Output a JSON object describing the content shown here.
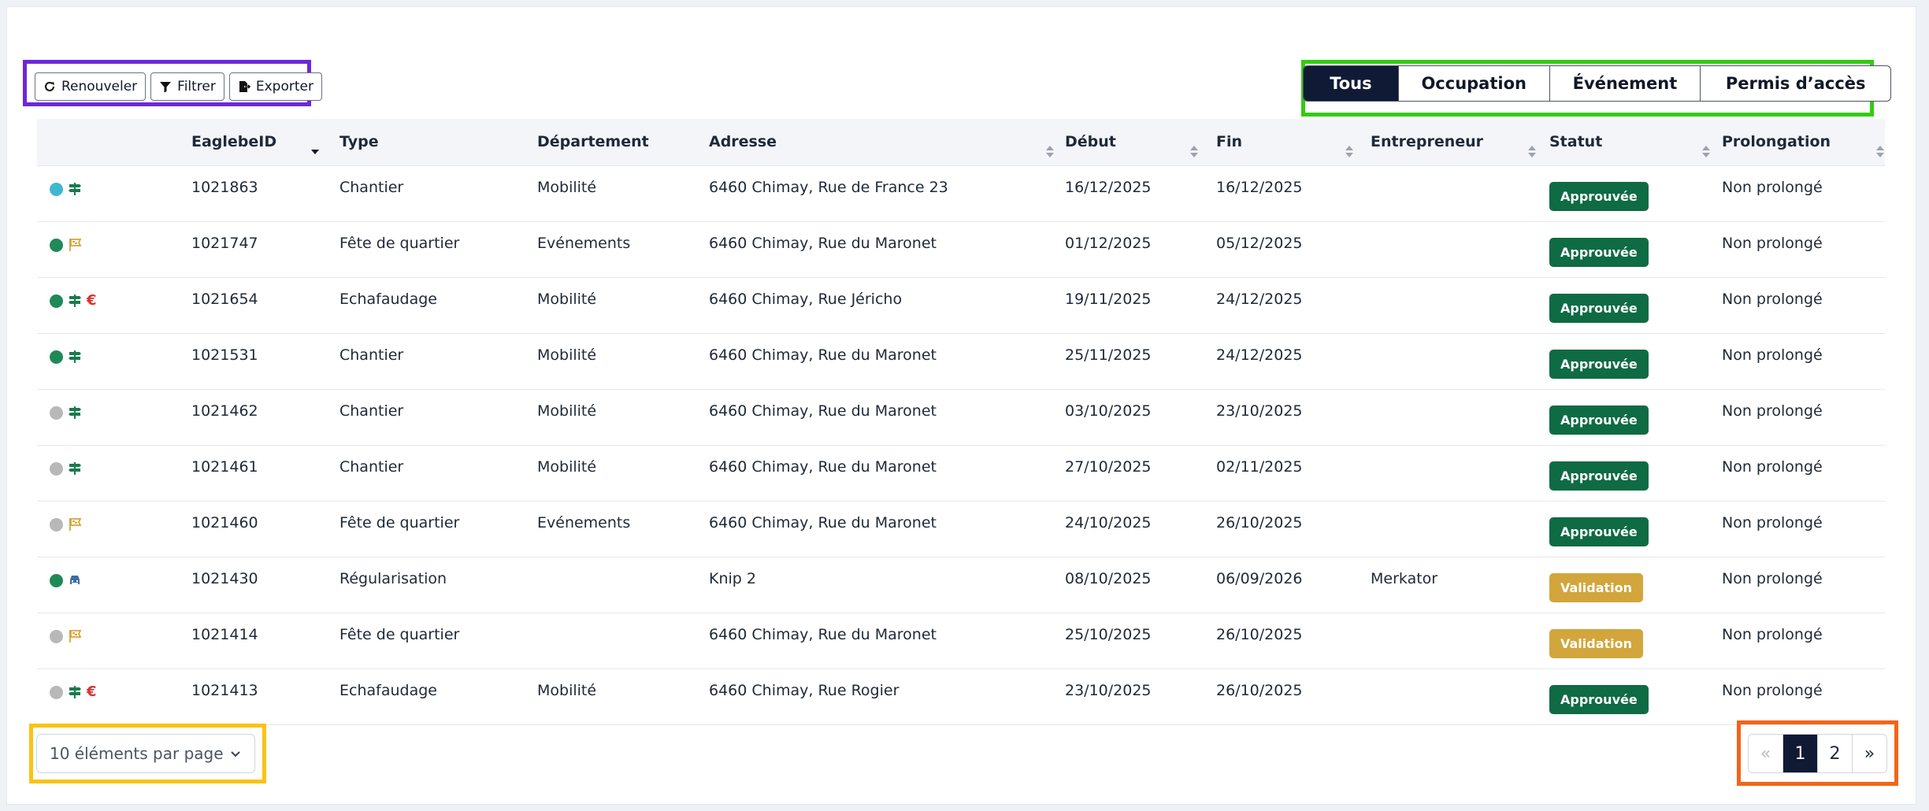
{
  "toolbar": {
    "renew_label": "Renouveler",
    "filter_label": "Filtrer",
    "export_label": "Exporter"
  },
  "tabs": [
    {
      "label": "Tous",
      "active": true
    },
    {
      "label": "Occupation",
      "active": false
    },
    {
      "label": "Événement",
      "active": false
    },
    {
      "label": "Permis d’accès",
      "active": false
    }
  ],
  "table": {
    "columns": [
      "EaglebeID",
      "Type",
      "Département",
      "Adresse",
      "Début",
      "Fin",
      "Entrepreneur",
      "Statut",
      "Prolongation"
    ],
    "rows": [
      {
        "dot": "#3fb8cf",
        "kind": "roadsign",
        "euro": false,
        "id": "1021863",
        "type": "Chantier",
        "dept": "Mobilité",
        "address": "6460 Chimay, Rue de France 23",
        "start": "16/12/2025",
        "end": "16/12/2025",
        "contractor": "",
        "status": "Approuvée",
        "status_kind": "approved",
        "extension": "Non prolongé"
      },
      {
        "dot": "#1f8a57",
        "kind": "flag",
        "euro": false,
        "id": "1021747",
        "type": "Fête de quartier",
        "dept": "Evénements",
        "address": "6460 Chimay, Rue du Maronet",
        "start": "01/12/2025",
        "end": "05/12/2025",
        "contractor": "",
        "status": "Approuvée",
        "status_kind": "approved",
        "extension": "Non prolongé"
      },
      {
        "dot": "#1f8a57",
        "kind": "roadsign",
        "euro": true,
        "id": "1021654",
        "type": "Echafaudage",
        "dept": "Mobilité",
        "address": "6460 Chimay, Rue Jéricho",
        "start": "19/11/2025",
        "end": "24/12/2025",
        "contractor": "",
        "status": "Approuvée",
        "status_kind": "approved",
        "extension": "Non prolongé"
      },
      {
        "dot": "#1f8a57",
        "kind": "roadsign",
        "euro": false,
        "id": "1021531",
        "type": "Chantier",
        "dept": "Mobilité",
        "address": "6460 Chimay, Rue du Maronet",
        "start": "25/11/2025",
        "end": "24/12/2025",
        "contractor": "",
        "status": "Approuvée",
        "status_kind": "approved",
        "extension": "Non prolongé"
      },
      {
        "dot": "#b8b8b8",
        "kind": "roadsign",
        "euro": false,
        "id": "1021462",
        "type": "Chantier",
        "dept": "Mobilité",
        "address": "6460 Chimay, Rue du Maronet",
        "start": "03/10/2025",
        "end": "23/10/2025",
        "contractor": "",
        "status": "Approuvée",
        "status_kind": "approved",
        "extension": "Non prolongé"
      },
      {
        "dot": "#b8b8b8",
        "kind": "roadsign",
        "euro": false,
        "id": "1021461",
        "type": "Chantier",
        "dept": "Mobilité",
        "address": "6460 Chimay, Rue du Maronet",
        "start": "27/10/2025",
        "end": "02/11/2025",
        "contractor": "",
        "status": "Approuvée",
        "status_kind": "approved",
        "extension": "Non prolongé"
      },
      {
        "dot": "#b8b8b8",
        "kind": "flag",
        "euro": false,
        "id": "1021460",
        "type": "Fête de quartier",
        "dept": "Evénements",
        "address": "6460 Chimay, Rue du Maronet",
        "start": "24/10/2025",
        "end": "26/10/2025",
        "contractor": "",
        "status": "Approuvée",
        "status_kind": "approved",
        "extension": "Non prolongé"
      },
      {
        "dot": "#1f8a57",
        "kind": "car",
        "euro": false,
        "id": "1021430",
        "type": "Régularisation",
        "dept": "",
        "address": "Knip 2",
        "start": "08/10/2025",
        "end": "06/09/2026",
        "contractor": "Merkator",
        "status": "Validation",
        "status_kind": "validation",
        "extension": "Non prolongé"
      },
      {
        "dot": "#b8b8b8",
        "kind": "flag",
        "euro": false,
        "id": "1021414",
        "type": "Fête de quartier",
        "dept": "",
        "address": "6460 Chimay, Rue du Maronet",
        "start": "25/10/2025",
        "end": "26/10/2025",
        "contractor": "",
        "status": "Validation",
        "status_kind": "validation",
        "extension": "Non prolongé"
      },
      {
        "dot": "#b8b8b8",
        "kind": "roadsign",
        "euro": true,
        "id": "1021413",
        "type": "Echafaudage",
        "dept": "Mobilité",
        "address": "6460 Chimay, Rue Rogier",
        "start": "23/10/2025",
        "end": "26/10/2025",
        "contractor": "",
        "status": "Approuvée",
        "status_kind": "approved",
        "extension": "Non prolongé"
      }
    ]
  },
  "euro_symbol": "€",
  "colors": {
    "approved": "#0e6b43",
    "validation": "#d2a63c",
    "primary": "#111a35",
    "roadsign": "#1a7a4c",
    "flag": "#d9a33a",
    "car": "#3a6ea5"
  },
  "footer": {
    "per_page_label": "10 éléments par page",
    "pagination": {
      "prev": "«",
      "pages": [
        "1",
        "2"
      ],
      "current": "1",
      "next": "»"
    }
  }
}
